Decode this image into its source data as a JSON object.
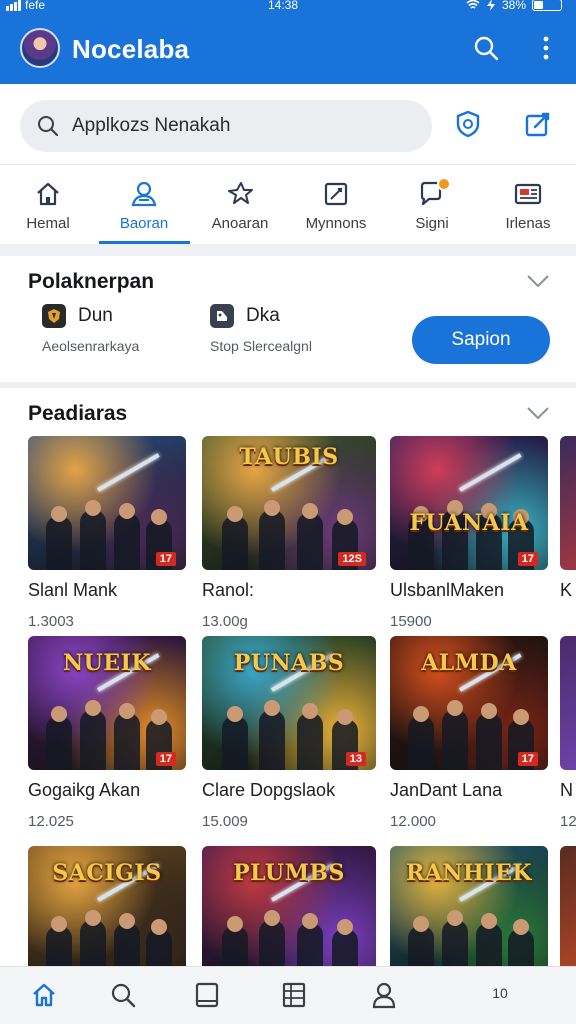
{
  "status_bar": {
    "carrier": "fefe",
    "time": "14:38",
    "battery": "38%"
  },
  "app_bar": {
    "title": "Nocelaba"
  },
  "search": {
    "placeholder": "Applkozs Nenakah"
  },
  "tabs": [
    {
      "label": "Hemal"
    },
    {
      "label": "Baoran"
    },
    {
      "label": "Anoaran"
    },
    {
      "label": "Mynnons"
    },
    {
      "label": "Signi",
      "badge_color": "#f39a1e"
    },
    {
      "label": "Irlenas"
    }
  ],
  "section1": {
    "title": "Polaknerpan",
    "cards": [
      {
        "title": "Dun",
        "subtitle": "Aeolsenrarkaya"
      },
      {
        "title": "Dka",
        "subtitle": "Stop Slercealgnl"
      }
    ],
    "button": "Sapion"
  },
  "section2": {
    "title": "Peadiaras",
    "games": [
      {
        "name": "Slanl Mank",
        "count": "1.3003",
        "rating": "17",
        "banner": "",
        "palette": [
          "#2d4f86",
          "#e3a347",
          "#4a2a5a"
        ]
      },
      {
        "name": "Ranol:",
        "count": "13.00g",
        "rating": "12S",
        "banner": "TAUBIS",
        "palette": [
          "#3b5a2e",
          "#e9a548",
          "#6c3b7a"
        ]
      },
      {
        "name": "UlsbanlMaken",
        "count": "15900",
        "rating": "17",
        "banner": "FUANAIA",
        "palette": [
          "#2c2260",
          "#cf3d5a",
          "#3ab0c6"
        ]
      },
      {
        "name": "Gogaikg Akan",
        "count": "12.025",
        "rating": "17",
        "banner": "NUEIK",
        "palette": [
          "#3a1a4d",
          "#8a44c4",
          "#e28b2a"
        ]
      },
      {
        "name": "Clare Dopgslaok",
        "count": "15.009",
        "rating": "13",
        "banner": "PUNABS",
        "palette": [
          "#284f2a",
          "#3ca6c9",
          "#e6b23a"
        ]
      },
      {
        "name": "JanDant Lana",
        "count": "12.000",
        "rating": "17",
        "banner": "ALMDA",
        "palette": [
          "#2a1410",
          "#d6501d",
          "#7a2416"
        ]
      },
      {
        "name": "",
        "count": "",
        "rating": "",
        "banner": "SACIGIS",
        "palette": [
          "#6b4a22",
          "#e6a540",
          "#3a2a1c"
        ]
      },
      {
        "name": "",
        "count": "",
        "rating": "",
        "banner": "PLUMBS",
        "palette": [
          "#3b1a52",
          "#c13a40",
          "#7a3ec0"
        ]
      },
      {
        "name": "",
        "count": "",
        "rating": "",
        "banner": "RANHIEK",
        "palette": [
          "#1e5a6e",
          "#e4b43c",
          "#2a7a3a"
        ]
      }
    ],
    "peek": [
      {
        "name": "K",
        "count": "",
        "palette": [
          "#3a2a5a",
          "#c23a3a"
        ]
      },
      {
        "name": "N",
        "count": "12",
        "palette": [
          "#4a2a6a",
          "#7a4ac0"
        ]
      },
      {
        "name": "",
        "count": "",
        "palette": [
          "#5a2a20",
          "#d0502a"
        ]
      }
    ]
  },
  "bottom_nav": {
    "items": [
      {
        "icon": "home-icon",
        "active": true
      },
      {
        "icon": "search-icon"
      },
      {
        "icon": "tablet-icon"
      },
      {
        "icon": "list-icon"
      },
      {
        "icon": "profile-icon"
      },
      {
        "icon": "more-label",
        "label": "10"
      }
    ]
  },
  "colors": {
    "primary": "#1a73d9",
    "background": "#eef0f3"
  }
}
